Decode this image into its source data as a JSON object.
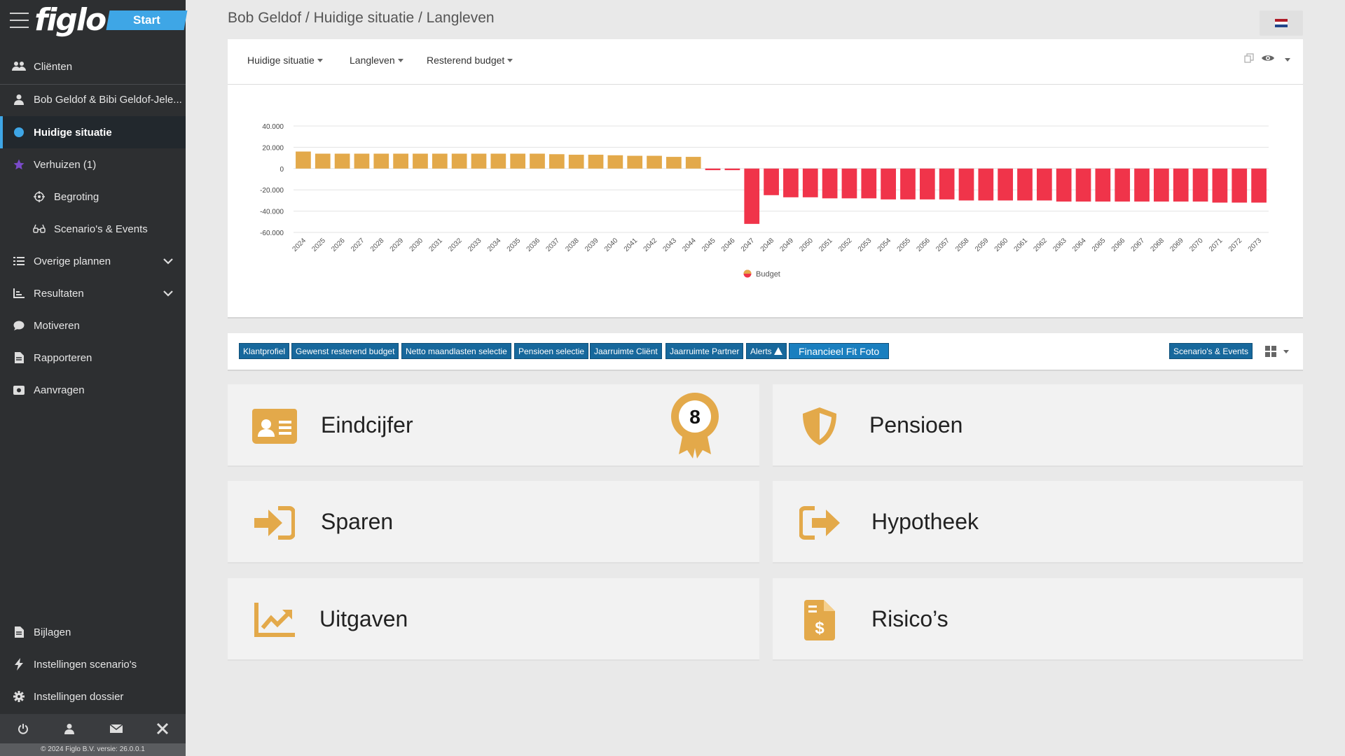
{
  "app": {
    "logo": "figlo",
    "start_label": "Start",
    "footer": "© 2024 Figlo B.V. versie: 26.0.0.1"
  },
  "sidebar": {
    "items": [
      {
        "label": "Cliënten",
        "icon": "users-icon"
      },
      {
        "label": "Bob Geldof & Bibi Geldof-Jele...",
        "icon": "user-icon"
      },
      {
        "label": "Huidige situatie",
        "icon": "circle-dot-icon"
      },
      {
        "label": "Verhuizen (1)",
        "icon": "star-icon"
      },
      {
        "label": "Begroting",
        "icon": "crosshair-icon"
      },
      {
        "label": "Scenario's & Events",
        "icon": "glasses-icon"
      },
      {
        "label": "Overige plannen",
        "icon": "list-icon"
      },
      {
        "label": "Resultaten",
        "icon": "chart-axis-icon"
      },
      {
        "label": "Motiveren",
        "icon": "speech-bubble-icon"
      },
      {
        "label": "Rapporteren",
        "icon": "document-icon"
      },
      {
        "label": "Aanvragen",
        "icon": "request-icon"
      },
      {
        "label": "Bijlagen",
        "icon": "file-icon"
      },
      {
        "label": "Instellingen scenario's",
        "icon": "bolt-icon"
      },
      {
        "label": "Instellingen dossier",
        "icon": "gear-icon"
      }
    ],
    "bottom_icons": [
      "power-icon",
      "user-icon",
      "mail-icon",
      "tools-icon"
    ]
  },
  "header": {
    "breadcrumb": "Bob Geldof / Huidige situatie / Langleven"
  },
  "chart_header": {
    "dropdowns": [
      "Huidige situatie",
      "Langleven",
      "Resterend budget"
    ]
  },
  "tags": [
    "Klantprofiel",
    "Gewenst resterend budget",
    "Netto maandlasten selectie",
    "Pensioen selectie",
    "Jaarruimte Cliënt",
    "Jaarruimte Partner",
    "Alerts",
    "Financieel Fit Foto"
  ],
  "tags_right": "Scenario's & Events",
  "cards": [
    {
      "title": "Eindcijfer",
      "icon": "id-card-icon",
      "badge": "8"
    },
    {
      "title": "Pensioen",
      "icon": "shield-icon"
    },
    {
      "title": "Sparen",
      "icon": "sign-in-icon"
    },
    {
      "title": "Hypotheek",
      "icon": "sign-out-icon"
    },
    {
      "title": "Uitgaven",
      "icon": "chart-line-icon"
    },
    {
      "title": "Risico’s",
      "icon": "invoice-dollar-icon"
    }
  ],
  "colors": {
    "positive": "#e3a94a",
    "negative": "#f0344a",
    "accent": "#3ea6e6",
    "tag": "#17689c",
    "card_icon": "#e3a94a"
  },
  "chart_data": {
    "type": "bar",
    "series": [
      {
        "name": "Budget",
        "values": [
          16000,
          14000,
          14000,
          14000,
          14000,
          14000,
          14000,
          14000,
          14000,
          14000,
          14000,
          14000,
          14000,
          13500,
          13000,
          13000,
          12500,
          12000,
          12000,
          11000,
          11000,
          -1500,
          -1500,
          -52000,
          -25000,
          -27000,
          -27000,
          -28000,
          -28000,
          -28000,
          -29000,
          -29000,
          -29000,
          -29000,
          -30000,
          -30000,
          -30000,
          -30000,
          -30000,
          -31000,
          -31000,
          -31000,
          -31000,
          -31000,
          -31000,
          -31000,
          -31000,
          -32000,
          -32000,
          -32000
        ]
      }
    ],
    "categories": [
      "2024",
      "2025",
      "2026",
      "2027",
      "2028",
      "2029",
      "2030",
      "2031",
      "2032",
      "2033",
      "2034",
      "2035",
      "2036",
      "2037",
      "2038",
      "2039",
      "2040",
      "2041",
      "2042",
      "2043",
      "2044",
      "2045",
      "2046",
      "2047",
      "2048",
      "2049",
      "2050",
      "2051",
      "2052",
      "2053",
      "2054",
      "2055",
      "2056",
      "2057",
      "2058",
      "2059",
      "2060",
      "2061",
      "2062",
      "2063",
      "2064",
      "2065",
      "2066",
      "2067",
      "2068",
      "2069",
      "2070",
      "2071",
      "2072",
      "2073"
    ],
    "y_ticks": [
      "40.000",
      "20.000",
      "0",
      "-20.000",
      "-40.000",
      "-60.000"
    ],
    "ylim": [
      -60000,
      40000
    ],
    "legend": "Budget",
    "legend_position": "bottom",
    "grid": true
  }
}
